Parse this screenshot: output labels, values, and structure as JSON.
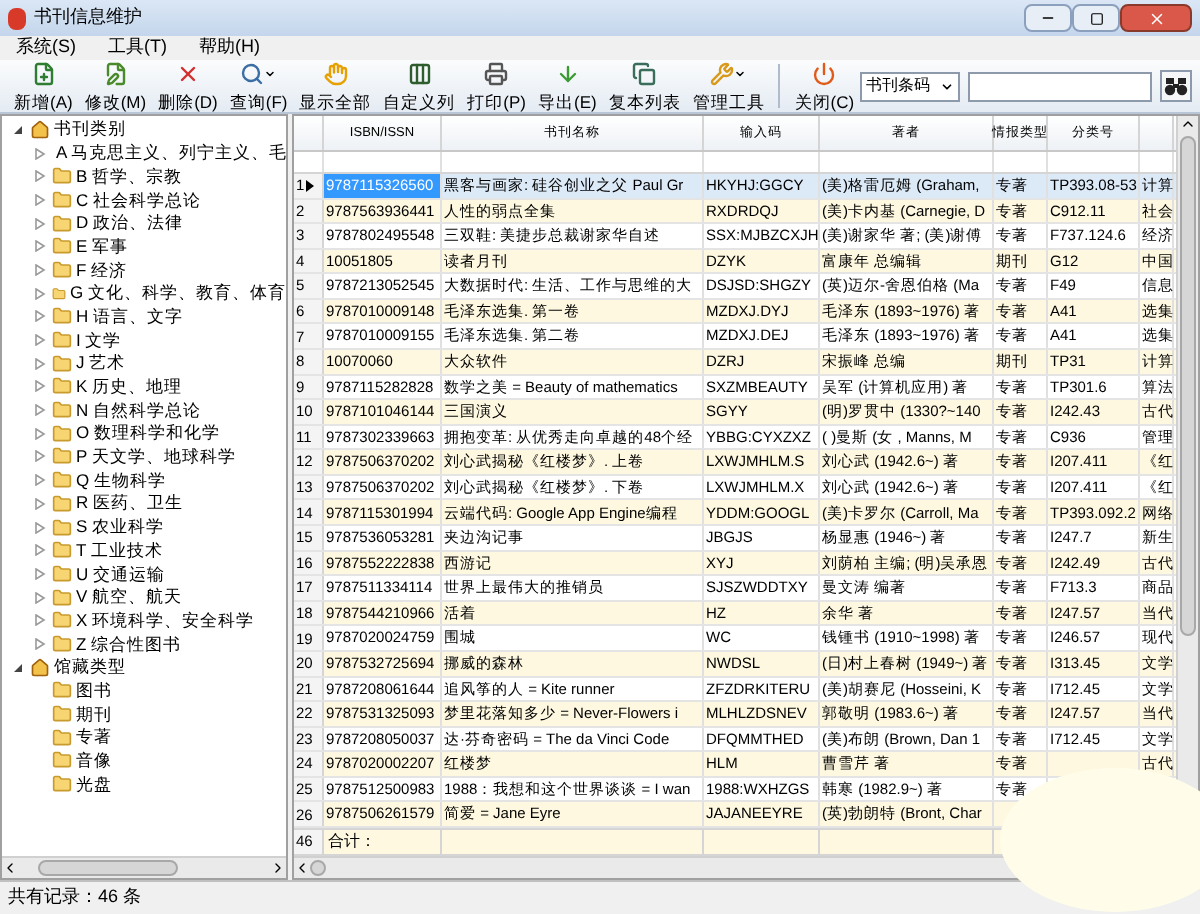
{
  "window": {
    "title": "书刊信息维护"
  },
  "menu": [
    "系统(S)",
    "工具(T)",
    "帮助(H)"
  ],
  "toolbar": [
    {
      "label": "新增(A)",
      "kind": "new",
      "dropdown": false
    },
    {
      "label": "修改(M)",
      "kind": "edit",
      "dropdown": false
    },
    {
      "label": "删除(D)",
      "kind": "delete",
      "dropdown": false
    },
    {
      "label": "查询(F)",
      "kind": "query",
      "dropdown": true
    },
    {
      "label": "显示全部",
      "kind": "showall",
      "dropdown": false
    },
    {
      "label": "自定义列",
      "kind": "columns",
      "dropdown": false
    },
    {
      "label": "打印(P)",
      "kind": "print",
      "dropdown": false
    },
    {
      "label": "导出(E)",
      "kind": "export",
      "dropdown": false
    },
    {
      "label": "复本列表",
      "kind": "copies",
      "dropdown": false
    },
    {
      "label": "管理工具",
      "kind": "tools",
      "dropdown": true
    },
    {
      "label": "关闭(C)",
      "kind": "close",
      "dropdown": false
    }
  ],
  "search": {
    "field": "书刊条码"
  },
  "tree": [
    {
      "label": "书刊类别",
      "expanded": true,
      "children": [
        {
          "label": "A 马克思主义、列宁主义、毛",
          "expanded": false
        },
        {
          "label": "B 哲学、宗教",
          "expanded": false
        },
        {
          "label": "C 社会科学总论",
          "expanded": false
        },
        {
          "label": "D 政治、法律",
          "expanded": false
        },
        {
          "label": "E 军事",
          "expanded": false
        },
        {
          "label": "F 经济",
          "expanded": false
        },
        {
          "label": "G 文化、科学、教育、体育",
          "expanded": false
        },
        {
          "label": "H 语言、文字",
          "expanded": false
        },
        {
          "label": "I 文学",
          "expanded": false
        },
        {
          "label": "J 艺术",
          "expanded": false
        },
        {
          "label": "K 历史、地理",
          "expanded": false
        },
        {
          "label": "N 自然科学总论",
          "expanded": false
        },
        {
          "label": "O 数理科学和化学",
          "expanded": false
        },
        {
          "label": "P 天文学、地球科学",
          "expanded": false
        },
        {
          "label": "Q 生物科学",
          "expanded": false
        },
        {
          "label": "R 医药、卫生",
          "expanded": false
        },
        {
          "label": "S 农业科学",
          "expanded": false
        },
        {
          "label": "T 工业技术",
          "expanded": false
        },
        {
          "label": "U 交通运输",
          "expanded": false
        },
        {
          "label": "V 航空、航天",
          "expanded": false
        },
        {
          "label": "X 环境科学、安全科学",
          "expanded": false
        },
        {
          "label": "Z 综合性图书",
          "expanded": false
        }
      ]
    },
    {
      "label": "馆藏类型",
      "expanded": true,
      "children": [
        {
          "label": "图书"
        },
        {
          "label": "期刊"
        },
        {
          "label": "专著"
        },
        {
          "label": "音像"
        },
        {
          "label": "光盘"
        }
      ]
    }
  ],
  "table": {
    "columns": [
      "ISBN/ISSN",
      "书刊名称",
      "输入码",
      "著者",
      "情报类型",
      "分类号"
    ],
    "rows": [
      {
        "number": "1",
        "selected": true,
        "cells": [
          "9787115326560",
          "黑客与画家: 硅谷创业之父 Paul Gr",
          "HKYHJ:GGCY",
          "(美)格雷厄姆 (Graham,",
          "专著",
          "TP393.08-53",
          "计算"
        ]
      },
      {
        "number": "2",
        "selected": false,
        "cells": [
          "9787563936441",
          "人性的弱点全集",
          "RXDRDQJ",
          "(美)卡内基 (Carnegie, D",
          "专著",
          "C912.11",
          "社会"
        ]
      },
      {
        "number": "3",
        "selected": false,
        "cells": [
          "9787802495548",
          "三双鞋: 美捷步总裁谢家华自述",
          "SSX:MJBZCXJH",
          "(美)谢家华 著; (美)谢傅",
          "专著",
          "F737.124.6",
          "经济"
        ]
      },
      {
        "number": "4",
        "selected": false,
        "cells": [
          "10051805",
          "读者月刊",
          "DZYK",
          "富康年 总编辑",
          "期刊",
          "G12",
          "中国"
        ]
      },
      {
        "number": "5",
        "selected": false,
        "cells": [
          "9787213052545",
          "大数据时代: 生活、工作与思维的大",
          "DSJSD:SHGZY",
          "(英)迈尔-舍恩伯格 (Ma",
          "专著",
          "F49",
          "信息"
        ]
      },
      {
        "number": "6",
        "selected": false,
        "cells": [
          "9787010009148",
          "毛泽东选集. 第一卷",
          "MZDXJ.DYJ",
          "毛泽东 (1893~1976) 著",
          "专著",
          "A41",
          "选集"
        ]
      },
      {
        "number": "7",
        "selected": false,
        "cells": [
          "9787010009155",
          "毛泽东选集. 第二卷",
          "MZDXJ.DEJ",
          "毛泽东 (1893~1976) 著",
          "专著",
          "A41",
          "选集"
        ]
      },
      {
        "number": "8",
        "selected": false,
        "cells": [
          "10070060",
          "大众软件",
          "DZRJ",
          "宋振峰 总编",
          "期刊",
          "TP31",
          "计算"
        ]
      },
      {
        "number": "9",
        "selected": false,
        "cells": [
          "9787115282828",
          "数学之美 = Beauty of mathematics",
          "SXZMBEAUTY",
          "吴军 (计算机应用) 著",
          "专著",
          "TP301.6",
          "算法"
        ]
      },
      {
        "number": "10",
        "selected": false,
        "cells": [
          "9787101046144",
          "三国演义",
          "SGYY",
          "(明)罗贯中 (1330?~140",
          "专著",
          "I242.43",
          "古代"
        ]
      },
      {
        "number": "11",
        "selected": false,
        "cells": [
          "9787302339663",
          "拥抱变革: 从优秀走向卓越的48个经",
          "YBBG:CYXZXZ",
          "( )曼斯 (女 , Manns, M",
          "专著",
          "C936",
          "管理"
        ]
      },
      {
        "number": "12",
        "selected": false,
        "cells": [
          "9787506370202",
          "刘心武揭秘《红楼梦》. 上卷",
          "LXWJMHLM.S",
          "刘心武 (1942.6~) 著",
          "专著",
          "I207.411",
          "《红"
        ]
      },
      {
        "number": "13",
        "selected": false,
        "cells": [
          "9787506370202",
          "刘心武揭秘《红楼梦》. 下卷",
          "LXWJMHLM.X",
          "刘心武 (1942.6~) 著",
          "专著",
          "I207.411",
          "《红"
        ]
      },
      {
        "number": "14",
        "selected": false,
        "cells": [
          "9787115301994",
          "云端代码: Google App Engine编程",
          "YDDM:GOOGL",
          "(美)卡罗尔 (Carroll, Ma",
          "专著",
          "TP393.092.2",
          "网络"
        ]
      },
      {
        "number": "15",
        "selected": false,
        "cells": [
          "9787536053281",
          "夹边沟记事",
          "JBGJS",
          "杨显惠 (1946~) 著",
          "专著",
          "I247.7",
          "新生"
        ]
      },
      {
        "number": "16",
        "selected": false,
        "cells": [
          "9787552222838",
          "西游记",
          "XYJ",
          "刘荫柏 主编; (明)吴承恩",
          "专著",
          "I242.49",
          "古代"
        ]
      },
      {
        "number": "17",
        "selected": false,
        "cells": [
          "9787511334114",
          "世界上最伟大的推销员",
          "SJSZWDDTXY",
          "曼文涛 编著",
          "专著",
          "F713.3",
          "商品"
        ]
      },
      {
        "number": "18",
        "selected": false,
        "cells": [
          "9787544210966",
          "活着",
          "HZ",
          "余华 著",
          "专著",
          "I247.57",
          "当代"
        ]
      },
      {
        "number": "19",
        "selected": false,
        "cells": [
          "9787020024759",
          "围城",
          "WC",
          "钱锺书 (1910~1998) 著",
          "专著",
          "I246.57",
          "现代"
        ]
      },
      {
        "number": "20",
        "selected": false,
        "cells": [
          "9787532725694",
          "挪威的森林",
          "NWDSL",
          "(日)村上春树 (1949~) 著",
          "专著",
          "I313.45",
          "文学"
        ]
      },
      {
        "number": "21",
        "selected": false,
        "cells": [
          "9787208061644",
          "追风筝的人 = Kite runner",
          "ZFZDRKITERU",
          "(美)胡赛尼 (Hosseini, K",
          "专著",
          "I712.45",
          "文学"
        ]
      },
      {
        "number": "22",
        "selected": false,
        "cells": [
          "9787531325093",
          "梦里花落知多少 = Never-Flowers i",
          "MLHLZDSNEV",
          "郭敬明 (1983.6~) 著",
          "专著",
          "I247.57",
          "当代"
        ]
      },
      {
        "number": "23",
        "selected": false,
        "cells": [
          "9787208050037",
          "达·芬奇密码 = The da Vinci Code",
          "DFQMMTHED",
          "(美)布朗 (Brown, Dan 1",
          "专著",
          "I712.45",
          "文学"
        ]
      },
      {
        "number": "24",
        "selected": false,
        "cells": [
          "9787020002207",
          "红楼梦",
          "HLM",
          "曹雪芹 著",
          "专著",
          null,
          "古代"
        ]
      },
      {
        "number": "25",
        "selected": false,
        "cells": [
          "9787512500983",
          "1988：我想和这个世界谈谈 = I wan",
          "1988:WXHZGS",
          "韩寒 (1982.9~) 著",
          "专著"
        ]
      },
      {
        "number": "26",
        "selected": false,
        "cells": [
          "9787506261579",
          "简爱 = Jane Eyre",
          "JAJANEEYRE",
          "(英)勃朗特 (Bront, Char"
        ]
      }
    ],
    "total": {
      "number": "46",
      "label": "合计："
    }
  },
  "status_bar": "共有记录：46 条"
}
